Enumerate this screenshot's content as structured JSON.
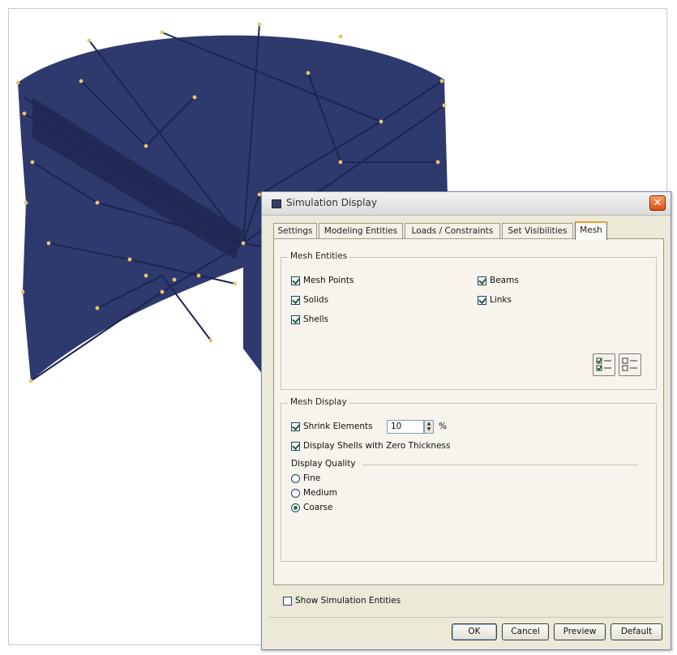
{
  "dialog": {
    "title": "Simulation Display",
    "close_glyph": "✕",
    "tabs": [
      "Settings",
      "Modeling Entities",
      "Loads / Constraints",
      "Set Visibilities",
      "Mesh"
    ],
    "active_tab": "Mesh",
    "mesh_entities": {
      "group_label": "Mesh Entities",
      "mesh_points": {
        "label": "Mesh Points",
        "checked": true
      },
      "beams": {
        "label": "Beams",
        "checked": true
      },
      "solids": {
        "label": "Solids",
        "checked": true
      },
      "links": {
        "label": "Links",
        "checked": true
      },
      "shells": {
        "label": "Shells",
        "checked": true
      },
      "select_all_icon": "select-all-icon",
      "clear_all_icon": "clear-all-icon"
    },
    "mesh_display": {
      "group_label": "Mesh Display",
      "shrink_elements": {
        "label": "Shrink Elements",
        "checked": true,
        "value": "10",
        "unit": "%"
      },
      "zero_thickness": {
        "label": "Display Shells with Zero Thickness",
        "checked": true
      },
      "display_quality": {
        "label": "Display Quality",
        "options": [
          "Fine",
          "Medium",
          "Coarse"
        ],
        "selected": "Coarse"
      }
    },
    "show_simulation_entities": {
      "label": "Show Simulation Entities",
      "checked": false
    },
    "buttons": {
      "ok": "OK",
      "cancel": "Cancel",
      "preview": "Preview",
      "default": "Default"
    }
  },
  "viewport": {
    "model_color": "#2e3a6e",
    "edge_color": "#1c2450",
    "node_color": "#e8c66a",
    "icon": "mesh-model-icon"
  }
}
